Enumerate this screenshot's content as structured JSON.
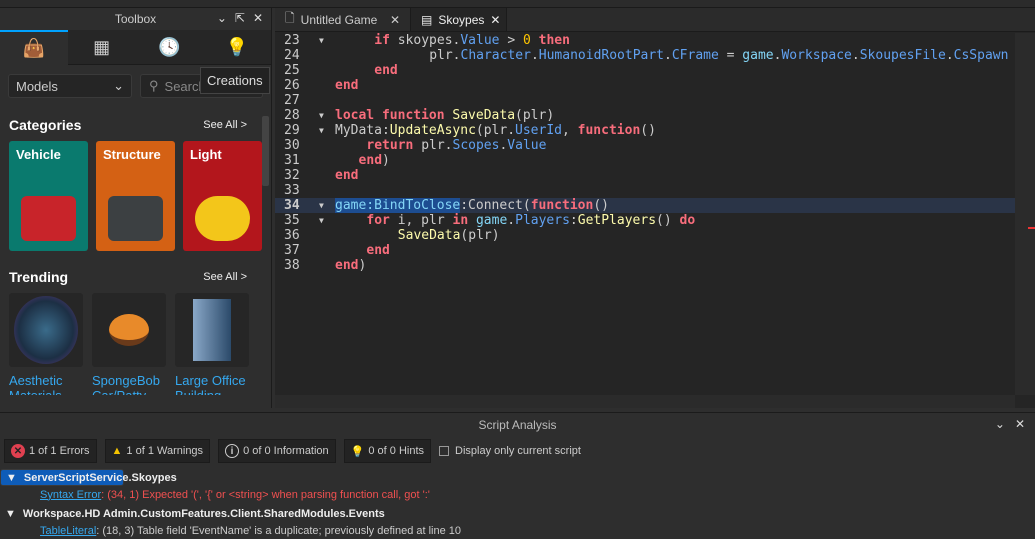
{
  "toolbox": {
    "title": "Toolbox",
    "tabs": [
      {
        "icon": "shopping-bag-icon"
      },
      {
        "icon": "grid-icon"
      },
      {
        "icon": "clock-icon"
      },
      {
        "icon": "lightbulb-icon"
      }
    ],
    "category_select": "Models",
    "search_placeholder": "Search",
    "tooltip": "Creations",
    "categories_heading": "Categories",
    "see_all": "See All >",
    "categories": [
      {
        "label": "Vehicle",
        "color": "#0a7a6e"
      },
      {
        "label": "Structure",
        "color": "#d46114"
      },
      {
        "label": "Light",
        "color": "#b3161c"
      }
    ],
    "trending_heading": "Trending",
    "trending": [
      "Aesthetic Materials",
      "SpongeBob Car/Patty",
      "Large Office Building"
    ]
  },
  "editor": {
    "tabs": [
      {
        "label": "Untitled Game",
        "icon": "game-file-icon"
      },
      {
        "label": "Skoypes",
        "icon": "script-icon"
      }
    ],
    "lines": [
      {
        "n": "23",
        "fold": true,
        "ind": 5,
        "t": [
          [
            "if ",
            "kw"
          ],
          [
            "skoypes.",
            "df"
          ],
          [
            "Value",
            "pr"
          ],
          [
            " > ",
            "df"
          ],
          [
            "0",
            "nm"
          ],
          [
            " then",
            "kw"
          ]
        ]
      },
      {
        "n": "24",
        "fold": false,
        "ind": 12,
        "t": [
          [
            "plr.",
            "df"
          ],
          [
            "Character",
            "pr"
          ],
          [
            ".",
            "df"
          ],
          [
            "HumanoidRootPart",
            "pr"
          ],
          [
            ".",
            "df"
          ],
          [
            "CFrame",
            "pr"
          ],
          [
            " = ",
            "df"
          ],
          [
            "game",
            "bi"
          ],
          [
            ".",
            "df"
          ],
          [
            "Workspace",
            "pr"
          ],
          [
            ".",
            "df"
          ],
          [
            "SkoupesFile",
            "pr"
          ],
          [
            ".",
            "df"
          ],
          [
            "CsSpawn",
            "pr"
          ]
        ]
      },
      {
        "n": "25",
        "fold": false,
        "ind": 5,
        "t": [
          [
            "end",
            "kw"
          ]
        ]
      },
      {
        "n": "26",
        "fold": false,
        "ind": 0,
        "t": [
          [
            "end",
            "kw"
          ]
        ]
      },
      {
        "n": "27",
        "fold": false,
        "ind": 0,
        "t": []
      },
      {
        "n": "28",
        "fold": true,
        "ind": 0,
        "t": [
          [
            "local function ",
            "kw"
          ],
          [
            "SaveData",
            "fn"
          ],
          [
            "(plr)",
            "df"
          ]
        ]
      },
      {
        "n": "29",
        "fold": true,
        "ind": 0,
        "t": [
          [
            "MyData:",
            "df"
          ],
          [
            "UpdateAsync",
            "fn"
          ],
          [
            "(plr.",
            "df"
          ],
          [
            "UserId",
            "pr"
          ],
          [
            ", ",
            "df"
          ],
          [
            "function",
            "kw"
          ],
          [
            "()",
            "df"
          ]
        ]
      },
      {
        "n": "30",
        "fold": false,
        "ind": 4,
        "t": [
          [
            "return ",
            "kw"
          ],
          [
            "plr.",
            "df"
          ],
          [
            "Scopes",
            "pr"
          ],
          [
            ".",
            "df"
          ],
          [
            "Value",
            "pr"
          ]
        ]
      },
      {
        "n": "31",
        "fold": false,
        "ind": 3,
        "t": [
          [
            "end",
            "kw"
          ],
          [
            ")",
            "df"
          ]
        ]
      },
      {
        "n": "32",
        "fold": false,
        "ind": 0,
        "t": [
          [
            "end",
            "kw"
          ]
        ]
      },
      {
        "n": "33",
        "fold": false,
        "ind": 0,
        "t": []
      },
      {
        "n": "34",
        "fold": true,
        "ind": 0,
        "current": true,
        "t": [
          [
            "game:BindToClose",
            "sel"
          ],
          [
            ":Connect(",
            "df"
          ],
          [
            "function",
            "kw"
          ],
          [
            "()",
            "df"
          ]
        ]
      },
      {
        "n": "35",
        "fold": true,
        "ind": 4,
        "t": [
          [
            "for ",
            "kw"
          ],
          [
            "i, plr ",
            "df"
          ],
          [
            "in ",
            "kw"
          ],
          [
            "game",
            "bi"
          ],
          [
            ".",
            "df"
          ],
          [
            "Players",
            "pr"
          ],
          [
            ":",
            "df"
          ],
          [
            "GetPlayers",
            "fn"
          ],
          [
            "() ",
            "df"
          ],
          [
            "do",
            "kw"
          ]
        ]
      },
      {
        "n": "36",
        "fold": false,
        "ind": 8,
        "t": [
          [
            "SaveData",
            "fn"
          ],
          [
            "(plr)",
            "df"
          ]
        ]
      },
      {
        "n": "37",
        "fold": false,
        "ind": 4,
        "t": [
          [
            "end",
            "kw"
          ]
        ]
      },
      {
        "n": "38",
        "fold": false,
        "ind": 0,
        "t": [
          [
            "end",
            "kw"
          ],
          [
            ")",
            "df"
          ]
        ]
      }
    ]
  },
  "analysis": {
    "title": "Script Analysis",
    "filters": {
      "errors": "1 of 1 Errors",
      "warnings": "1 of 1 Warnings",
      "information": "0 of 0 Information",
      "hints": "0 of 0 Hints"
    },
    "only_current": "Display only current script",
    "groups": [
      {
        "name": "ServerScriptService.Skoypes",
        "kind": "Syntax Error",
        "message": ": (34, 1) Expected '(', '{' or <string> when parsing function call, got ':'"
      },
      {
        "name": "Workspace.HD Admin.CustomFeatures.Client.SharedModules.Events",
        "kind": "TableLiteral",
        "message": ": (18, 3) Table field 'EventName' is a duplicate; previously defined at line 10"
      }
    ]
  }
}
